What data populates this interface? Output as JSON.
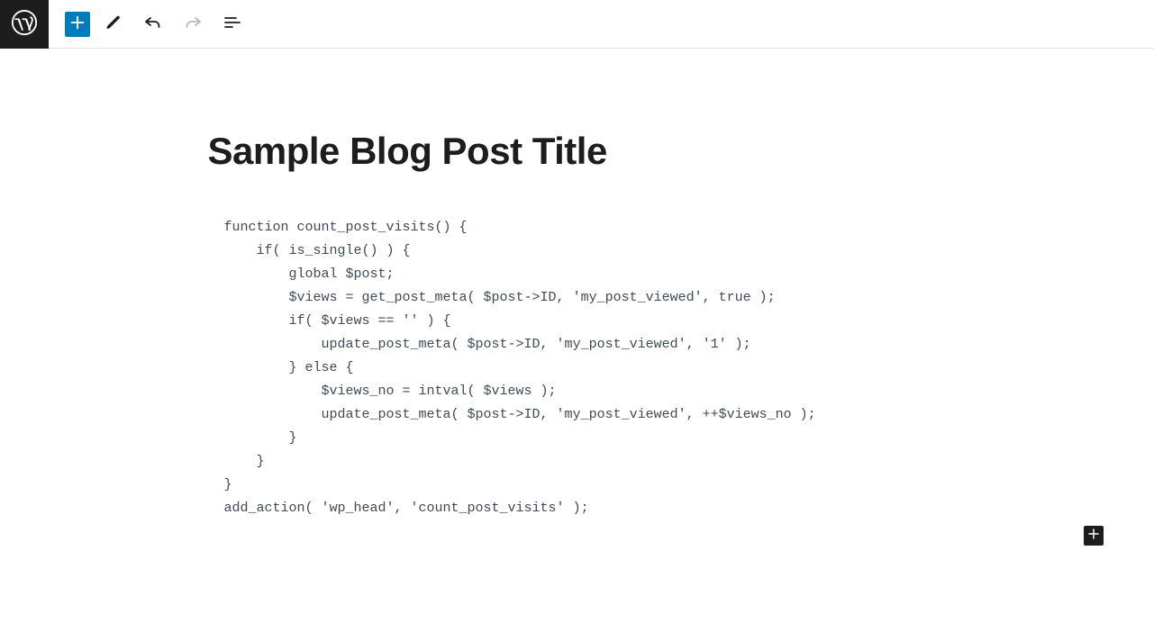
{
  "toolbar": {
    "logo_label": "WordPress",
    "add_block_label": "Add block",
    "edit_label": "Edit",
    "undo_label": "Undo",
    "redo_label": "Redo",
    "outline_label": "Document outline"
  },
  "post": {
    "title": "Sample Blog Post Title"
  },
  "code_block": {
    "lines": [
      "function count_post_visits() {",
      "    if( is_single() ) {",
      "        global $post;",
      "        $views = get_post_meta( $post->ID, 'my_post_viewed', true );",
      "        if( $views == '' ) {",
      "            update_post_meta( $post->ID, 'my_post_viewed', '1' );",
      "        } else {",
      "            $views_no = intval( $views );",
      "            update_post_meta( $post->ID, 'my_post_viewed', ++$views_no );",
      "        }",
      "    }",
      "}",
      "add_action( 'wp_head', 'count_post_visits' );"
    ]
  },
  "appender": {
    "label": "Add block"
  }
}
